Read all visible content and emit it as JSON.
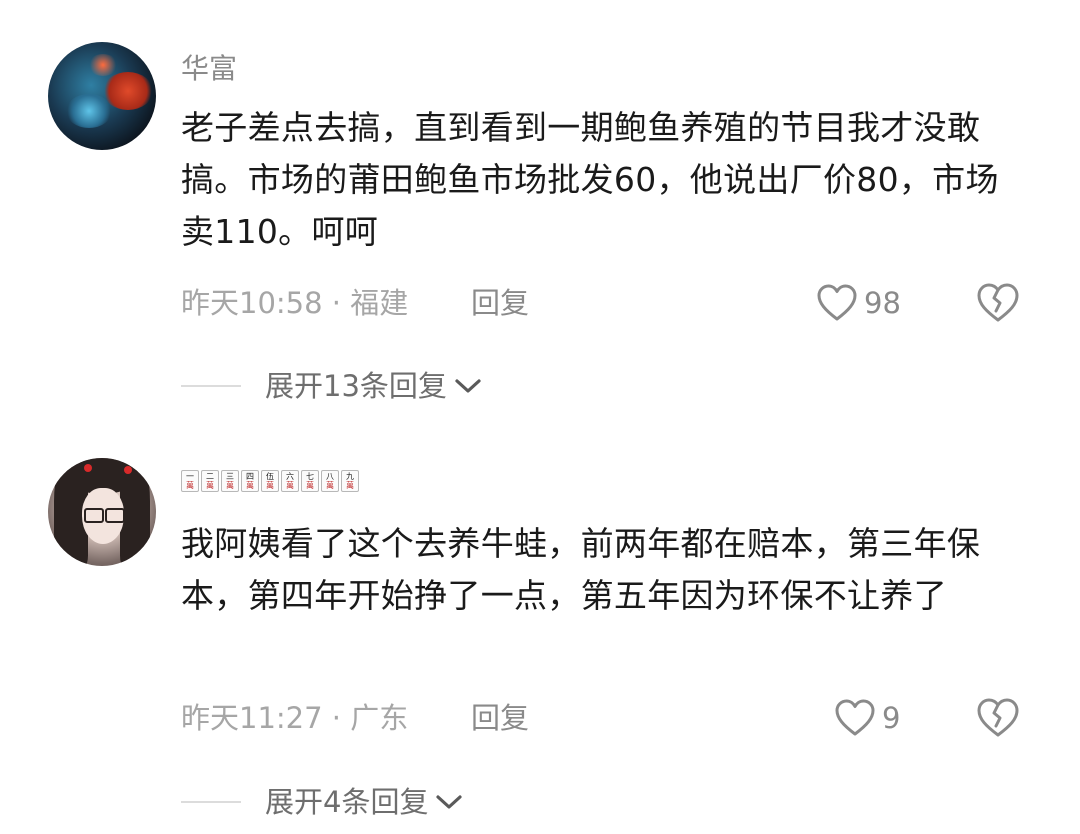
{
  "comments": [
    {
      "username": "华富",
      "username_style": "text",
      "text": "老子差点去搞，直到看到一期鲍鱼养殖的节目我才没敢搞。市场的莆田鲍鱼市场批发60，他说出厂价80，市场卖110。呵呵",
      "time": "昨天10:58",
      "location_sep": " · ",
      "location": "福建",
      "reply_label": "回复",
      "likes": "98",
      "expand_label": "展开13条回复",
      "avatar_icon": "abstract-avatar"
    },
    {
      "username": "一二三四五六七八九萬",
      "username_style": "mahjong-tiles",
      "tiles": [
        "一",
        "二",
        "三",
        "四",
        "伍",
        "六",
        "七",
        "八",
        "九"
      ],
      "tile_suit": "萬",
      "text": "我阿姨看了这个去养牛蛙，前两年都在赔本，第三年保本，第四年开始挣了一点，第五年因为环保不让养了",
      "time": "昨天11:27",
      "location_sep": " · ",
      "location": "广东",
      "reply_label": "回复",
      "likes": "9",
      "expand_label": "展开4条回复",
      "avatar_icon": "girl-avatar"
    }
  ],
  "icons": {
    "like": "heart-outline-icon",
    "dislike": "broken-heart-icon",
    "expand": "chevron-down-icon"
  },
  "colors": {
    "text": "#1a1a1a",
    "meta": "#a6a6a6",
    "username": "#8a8a8a",
    "icon": "#8a8a8a"
  }
}
